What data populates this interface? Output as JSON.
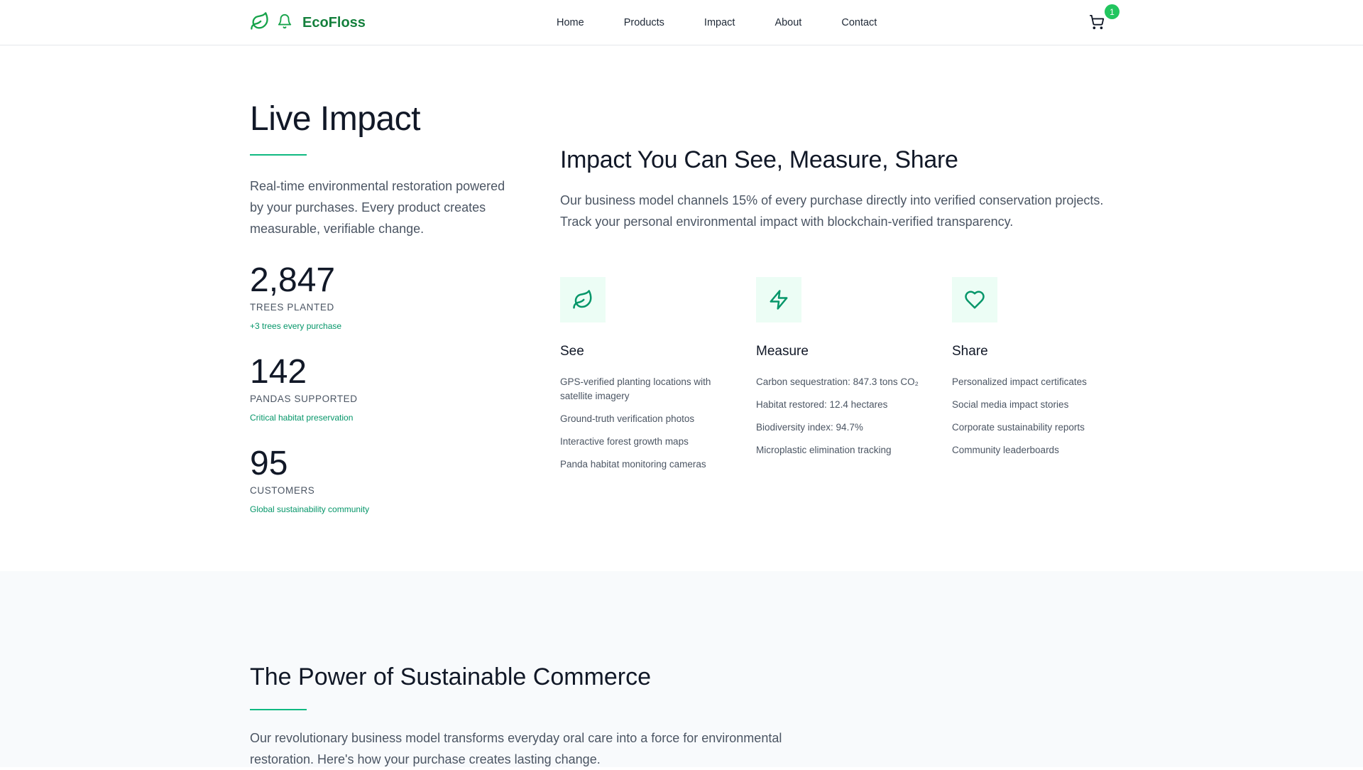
{
  "brand": {
    "name": "EcoFloss"
  },
  "nav": {
    "links": [
      "Home",
      "Products",
      "Impact",
      "About",
      "Contact"
    ],
    "cart_count": "1"
  },
  "live": {
    "title": "Live Impact",
    "intro": "Real-time environmental restoration powered by your purchases. Every product creates measurable, verifiable change.",
    "stats": [
      {
        "value": "2,847",
        "label": "TREES PLANTED",
        "note": "+3 trees every purchase"
      },
      {
        "value": "142",
        "label": "PANDAS SUPPORTED",
        "note": "Critical habitat preservation"
      },
      {
        "value": "95",
        "label": "CUSTOMERS",
        "note": "Global sustainability community"
      }
    ]
  },
  "impact": {
    "title": "Impact You Can See, Measure, Share",
    "description": "Our business model channels 15% of every purchase directly into verified conservation projects. Track your personal environmental impact with blockchain-verified transparency.",
    "pillars": [
      {
        "icon": "leaf-icon",
        "title": "See",
        "items": [
          "GPS-verified planting locations with satellite imagery",
          "Ground-truth verification photos",
          "Interactive forest growth maps",
          "Panda habitat monitoring cameras"
        ]
      },
      {
        "icon": "lightning-icon",
        "title": "Measure",
        "items": [
          "Carbon sequestration: 847.3 tons CO₂",
          "Habitat restored: 12.4 hectares",
          "Biodiversity index: 94.7%",
          "Microplastic elimination tracking"
        ]
      },
      {
        "icon": "heart-icon",
        "title": "Share",
        "items": [
          "Personalized impact certificates",
          "Social media impact stories",
          "Corporate sustainability reports",
          "Community leaderboards"
        ]
      }
    ]
  },
  "commerce": {
    "title": "The Power of Sustainable Commerce",
    "description": "Our revolutionary business model transforms everyday oral care into a force for environmental restoration. Here's how your purchase creates lasting change."
  },
  "colors": {
    "accent": "#10b981",
    "brand": "#15803d",
    "icon_bg": "#ecfdf5"
  }
}
